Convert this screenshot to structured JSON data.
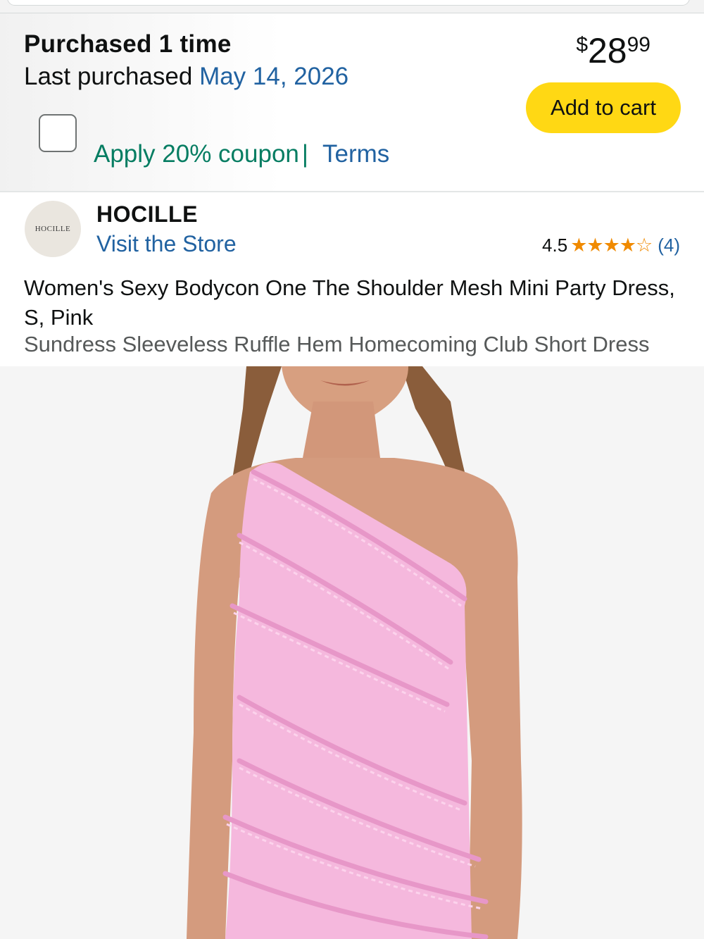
{
  "purchase": {
    "count_text": "Purchased 1 time",
    "last_label": "Last purchased",
    "last_date": "May 14, 2026"
  },
  "price": {
    "currency": "$",
    "whole": "28",
    "fraction": "99"
  },
  "actions": {
    "add_to_cart": "Add to cart"
  },
  "coupon": {
    "text": "Apply 20% coupon",
    "separator": "|",
    "terms": "Terms"
  },
  "store": {
    "logo_text": "HOCILLE",
    "brand": "HOCILLE",
    "visit": "Visit the Store"
  },
  "rating": {
    "value": "4.5",
    "stars": "★★★★☆",
    "count": "(4)"
  },
  "product": {
    "title": "Women's Sexy Bodycon One The Shoulder Mesh Mini Party Dress, S, Pink",
    "subtitle": "Sundress Sleeveless Ruffle Hem Homecoming Club Short Dress"
  },
  "colors": {
    "link": "#2162a1",
    "coupon": "#067d62",
    "cart_button": "#ffd814",
    "star": "#f08a00",
    "dress": "#f5b8dd"
  },
  "icons": [
    "checkbox-icon",
    "star-icon"
  ]
}
